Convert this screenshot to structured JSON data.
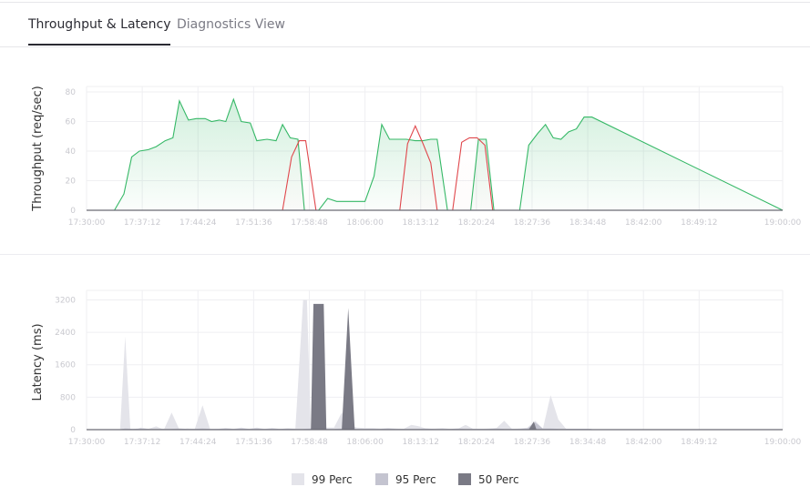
{
  "tabs": [
    {
      "label": "Throughput & Latency",
      "active": true
    },
    {
      "label": "Diagnostics View",
      "active": false
    }
  ],
  "colors": {
    "throughput_green": "#35b866",
    "throughput_red": "#e0474c",
    "grid": "#efeff2",
    "axis_text": "#c9c9cf",
    "p99": "#e4e4ea",
    "p95": "#c4c4d0",
    "p50": "#7a7a85"
  },
  "chart_data": [
    {
      "type": "area",
      "ylabel": "Throughput (req/sec)",
      "xlabel": "",
      "x_ticks": [
        "17:30:00",
        "17:37:12",
        "17:44:24",
        "17:51:36",
        "17:58:48",
        "18:06:00",
        "18:13:12",
        "18:20:24",
        "18:27:36",
        "18:34:48",
        "18:42:00",
        "18:49:12",
        "19:00:00"
      ],
      "y_ticks": [
        "0",
        "20",
        "40",
        "60",
        "80"
      ],
      "ylim": [
        0,
        80
      ],
      "grid": true,
      "series": [
        {
          "color": "throughput_green",
          "x": [
            "17:30:00",
            "17:33:36",
            "17:34:50",
            "17:35:50",
            "17:36:50",
            "17:38:00",
            "17:39:00",
            "17:40:10",
            "17:41:10",
            "17:42:00",
            "17:43:10",
            "17:44:10",
            "17:45:20",
            "17:46:10",
            "17:47:10",
            "17:48:00",
            "17:49:00",
            "17:50:00",
            "17:51:10",
            "17:52:00",
            "17:53:20",
            "17:54:30",
            "17:55:20",
            "17:56:20",
            "17:57:20",
            "17:58:10",
            "17:59:00",
            "18:00:00",
            "18:01:10",
            "18:02:20",
            "18:03:20",
            "18:04:20",
            "18:05:10",
            "18:06:00",
            "18:07:10",
            "18:08:10",
            "18:09:10",
            "18:10:20",
            "18:11:20",
            "18:12:30",
            "18:13:30",
            "18:14:30",
            "18:15:20",
            "18:16:40",
            "18:17:40",
            "18:18:40",
            "18:19:40",
            "18:20:40",
            "18:21:40",
            "18:22:40",
            "18:23:50",
            "18:25:00",
            "18:26:00",
            "18:27:10",
            "18:28:20",
            "18:29:20",
            "18:30:20",
            "18:31:20",
            "18:32:20",
            "18:33:20",
            "18:34:20",
            "18:35:20",
            "19:00:00"
          ],
          "values": [
            0,
            0,
            11,
            36,
            40,
            41,
            43,
            47,
            49,
            74,
            61,
            62,
            62,
            60,
            61,
            60,
            75,
            60,
            59,
            47,
            48,
            47,
            58,
            49,
            48,
            0,
            0,
            0,
            8,
            6,
            6,
            6,
            6,
            6,
            23,
            58,
            48,
            48,
            48,
            47,
            47,
            48,
            48,
            0,
            0,
            0,
            0,
            48,
            48,
            0,
            0,
            0,
            0,
            44,
            52,
            58,
            49,
            48,
            53,
            55,
            63,
            63,
            0
          ]
        },
        {
          "color": "throughput_red",
          "x": [
            "17:30:00",
            "17:55:20",
            "17:56:30",
            "17:57:30",
            "17:58:20",
            "17:59:40",
            "18:09:30",
            "18:10:30",
            "18:11:30",
            "18:12:30",
            "18:13:30",
            "18:14:30",
            "18:15:20",
            "18:17:20",
            "18:18:30",
            "18:19:30",
            "18:20:30",
            "18:21:30",
            "18:22:30",
            "19:00:00"
          ],
          "values": [
            0,
            0,
            36,
            47,
            47,
            0,
            0,
            0,
            45,
            57,
            45,
            32,
            0,
            0,
            46,
            49,
            49,
            44,
            0,
            0
          ]
        }
      ]
    },
    {
      "type": "area",
      "ylabel": "Latency (ms)",
      "xlabel": "",
      "x_ticks": [
        "17:30:00",
        "17:37:12",
        "17:44:24",
        "17:51:36",
        "17:58:48",
        "18:06:00",
        "18:13:12",
        "18:20:24",
        "18:27:36",
        "18:34:48",
        "18:42:00",
        "18:49:12",
        "19:00:00"
      ],
      "y_ticks": [
        "0",
        "800",
        "1600",
        "2400",
        "3200"
      ],
      "ylim": [
        0,
        3300
      ],
      "grid": true,
      "legend": "bottom",
      "series": [
        {
          "name": "99 Perc",
          "color": "p99",
          "x": [
            "17:30:00",
            "17:34:20",
            "17:35:00",
            "17:35:40",
            "17:36:20",
            "17:37:00",
            "17:38:00",
            "17:39:00",
            "17:40:00",
            "17:41:00",
            "17:42:00",
            "17:43:00",
            "17:44:00",
            "17:45:00",
            "17:46:00",
            "17:47:00",
            "17:48:00",
            "17:49:00",
            "17:50:00",
            "17:51:00",
            "17:52:00",
            "17:53:00",
            "17:54:00",
            "17:55:00",
            "17:56:00",
            "17:57:00",
            "17:58:00",
            "17:58:30",
            "17:59:00",
            "17:59:40",
            "18:00:20",
            "18:01:00",
            "18:02:00",
            "18:03:00",
            "18:04:00",
            "18:05:00",
            "18:06:00",
            "18:07:00",
            "18:08:00",
            "18:09:00",
            "18:10:00",
            "18:11:00",
            "18:12:00",
            "18:13:00",
            "18:14:00",
            "18:15:00",
            "18:16:00",
            "18:17:00",
            "18:18:00",
            "18:19:00",
            "18:20:00",
            "18:21:00",
            "18:22:00",
            "18:23:00",
            "18:24:00",
            "18:25:00",
            "18:26:00",
            "18:27:00",
            "18:28:00",
            "18:29:00",
            "18:30:00",
            "18:31:00",
            "18:32:00",
            "18:33:00",
            "18:34:00",
            "18:35:00",
            "18:36:00",
            "19:00:00"
          ],
          "values": [
            0,
            0,
            2300,
            0,
            0,
            50,
            20,
            80,
            0,
            420,
            0,
            30,
            20,
            600,
            0,
            20,
            40,
            20,
            50,
            20,
            50,
            20,
            40,
            20,
            30,
            30,
            3200,
            3200,
            40,
            40,
            100,
            50,
            50,
            420,
            100,
            50,
            40,
            40,
            30,
            40,
            30,
            20,
            120,
            80,
            20,
            30,
            40,
            20,
            20,
            120,
            20,
            20,
            30,
            40,
            220,
            20,
            30,
            50,
            220,
            20,
            850,
            250,
            20,
            20,
            20,
            20,
            0,
            0
          ]
        },
        {
          "name": "95 Perc",
          "color": "p95",
          "x": [
            "17:30:00",
            "17:34:00",
            "17:35:00",
            "17:36:00",
            "17:37:00",
            "17:38:00",
            "17:39:00",
            "17:40:00",
            "17:41:00",
            "17:42:00",
            "17:43:00",
            "17:44:00",
            "17:45:00",
            "17:46:00",
            "17:47:00",
            "17:48:00",
            "17:49:00",
            "17:50:00",
            "17:51:00",
            "17:52:00",
            "17:53:00",
            "17:54:00",
            "17:55:00",
            "17:56:00",
            "17:57:00",
            "17:58:00",
            "17:59:00",
            "18:00:00",
            "18:01:00",
            "18:02:00",
            "18:03:00",
            "18:04:00",
            "18:05:00",
            "18:06:00",
            "18:07:00",
            "18:08:00",
            "18:09:00",
            "18:10:00",
            "18:11:00",
            "18:12:00",
            "18:13:00",
            "18:14:00",
            "18:15:00",
            "18:16:00",
            "18:17:00",
            "18:18:00",
            "18:19:00",
            "18:20:00",
            "18:21:00",
            "18:22:00",
            "18:23:00",
            "18:24:00",
            "18:25:00",
            "18:26:00",
            "18:27:00",
            "18:28:00",
            "18:29:00",
            "18:30:00",
            "18:31:00",
            "18:32:00",
            "18:33:00",
            "18:34:00",
            "18:35:00",
            "18:36:00",
            "19:00:00"
          ],
          "values": [
            0,
            0,
            30,
            20,
            30,
            20,
            20,
            20,
            20,
            30,
            20,
            20,
            30,
            20,
            20,
            30,
            20,
            30,
            20,
            30,
            20,
            30,
            20,
            30,
            20,
            20,
            30,
            20,
            20,
            20,
            30,
            20,
            20,
            20,
            20,
            20,
            30,
            20,
            20,
            20,
            20,
            30,
            20,
            20,
            20,
            30,
            20,
            20,
            20,
            20,
            30,
            20,
            20,
            20,
            30,
            180,
            30,
            30,
            20,
            20,
            20,
            20,
            20,
            0,
            0
          ]
        },
        {
          "name": "50 Perc",
          "color": "p50",
          "x": [
            "17:30:00",
            "17:58:00",
            "17:59:00",
            "17:59:20",
            "18:00:40",
            "18:01:00",
            "18:03:00",
            "18:03:50",
            "18:04:40",
            "18:05:00",
            "18:26:20",
            "18:27:10",
            "18:27:50",
            "18:28:10",
            "19:00:00"
          ],
          "values": [
            0,
            0,
            0,
            3100,
            3100,
            0,
            0,
            3000,
            0,
            0,
            0,
            0,
            200,
            0,
            0
          ]
        }
      ]
    }
  ]
}
